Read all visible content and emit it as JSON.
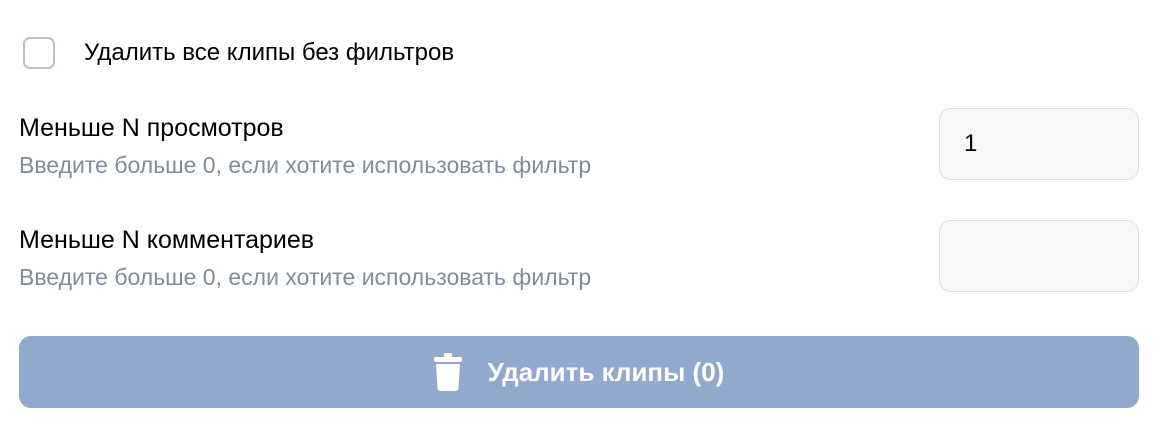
{
  "delete_all": {
    "label": "Удалить все клипы без фильтров",
    "checked": false
  },
  "filters": {
    "views": {
      "title": "Меньше N просмотров",
      "hint": "Введите больше 0, если хотите использовать фильтр",
      "value": "1"
    },
    "comments": {
      "title": "Меньше N комментариев",
      "hint": "Введите больше 0, если хотите использовать фильтр",
      "value": ""
    }
  },
  "delete_button": {
    "label": "Удалить клипы (0)",
    "icon": "trash-icon",
    "color": "#91a9cf"
  }
}
